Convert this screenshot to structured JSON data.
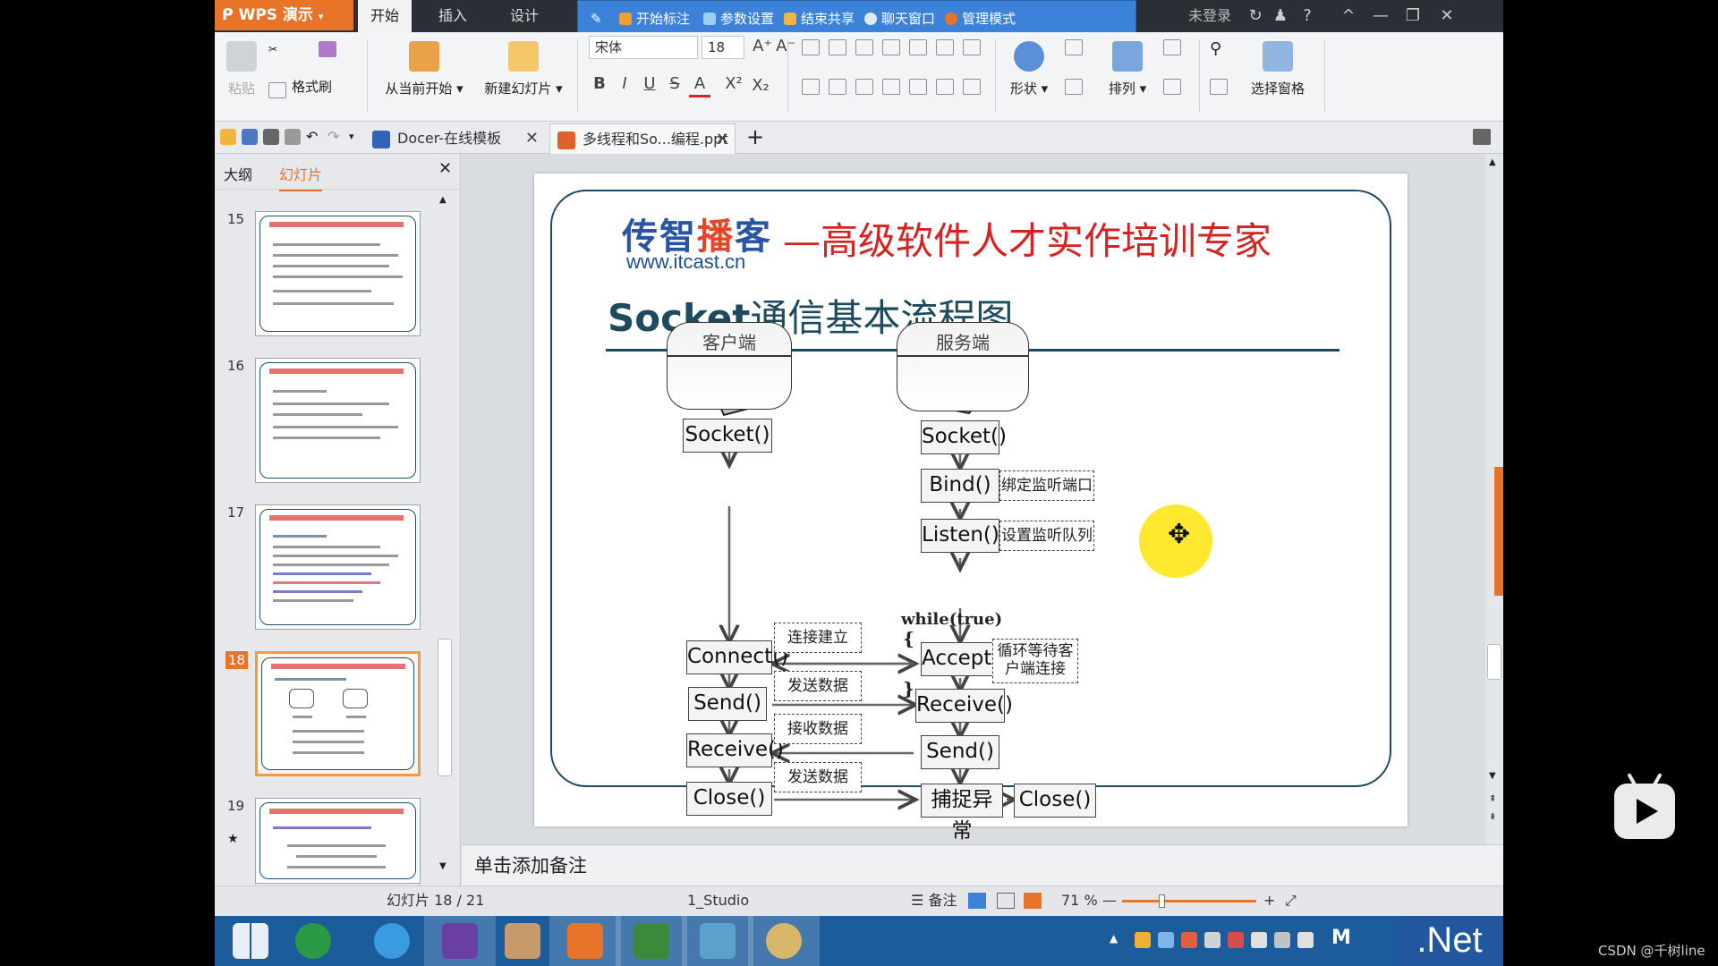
{
  "app": {
    "menu_label": "WPS 演示",
    "dropdown_glyph": "▾"
  },
  "menu_tabs": [
    "开始",
    "插入",
    "设计"
  ],
  "collab_bar": {
    "items": [
      "开始标注",
      "参数设置",
      "结束共享",
      "聊天窗口",
      "管理模式"
    ]
  },
  "login": "未登录",
  "window_controls": {
    "minimize": "—",
    "restore": "❐",
    "close": "✕",
    "collapse": "^",
    "help": "?"
  },
  "ribbon": {
    "paste": "粘贴",
    "format_painter": "格式刷",
    "from_current": "从当前开始",
    "new_slide": "新建幻灯片",
    "font_name": "宋体",
    "font_size": "18",
    "shapes": "形状",
    "arrange": "排列",
    "selection_pane": "选择窗格",
    "fmt_bold": "B",
    "fmt_italic": "I",
    "fmt_underline": "U",
    "fmt_strike": "S",
    "fmt_color": "A",
    "fmt_sup": "X²",
    "fmt_sub": "X₂",
    "grow": "A⁺",
    "shrink": "A⁻"
  },
  "doc_tabs": [
    {
      "label": "Docer-在线模板",
      "close": "✕"
    },
    {
      "label": "多线程和So...编程.ppt",
      "close": "✕"
    }
  ],
  "new_tab": "+",
  "left_panel": {
    "tab_outline": "大纲",
    "tab_slides": "幻灯片",
    "close": "✕",
    "slide_numbers": [
      "15",
      "16",
      "17",
      "18",
      "19"
    ]
  },
  "slide": {
    "logo_part1": "传智",
    "logo_part2": "播",
    "logo_part3": "客",
    "logo_url": "www.itcast.cn",
    "slogan": "—高级软件人才实作培训专家",
    "title_latin": "Socket",
    "title_cn": "通信基本流程图",
    "client_label": "客户端",
    "server_label": "服务端",
    "client_funcs": [
      "Socket()",
      "Connect()",
      "Send()",
      "Receive()",
      "Close()"
    ],
    "server_funcs": [
      "Socket()",
      "Bind()",
      "Listen()",
      "Accept()",
      "Receive()",
      "Send()",
      "捕捉异常",
      "Close()"
    ],
    "notes_bind": "绑定监听端口",
    "notes_listen": "设置监听队列",
    "notes_accept": "循环等待客户端连接",
    "notes_conn": "连接建立",
    "notes_send": "发送数据",
    "notes_recv": "接收数据",
    "notes_send2": "发送数据",
    "loop_text": "while(true)",
    "brace_open": "{",
    "brace_close": "}"
  },
  "notes_placeholder": "单击添加备注",
  "status": {
    "slide_counter": "幻灯片 18 / 21",
    "theme": "1_Studio",
    "notes_btn": "备注",
    "zoom": "71 %",
    "zoom_minus": "—",
    "zoom_plus": "+",
    "zoom_level": 0.3
  },
  "taskbar": {
    "dotnet": ".Net",
    "tray_m": "M"
  },
  "watermark": "CSDN @千树line",
  "colors": {
    "accent_orange": "#e8742a",
    "collab_blue": "#3c82d9",
    "slide_dark": "#1d4a5e",
    "slogan_red": "#d62222"
  }
}
